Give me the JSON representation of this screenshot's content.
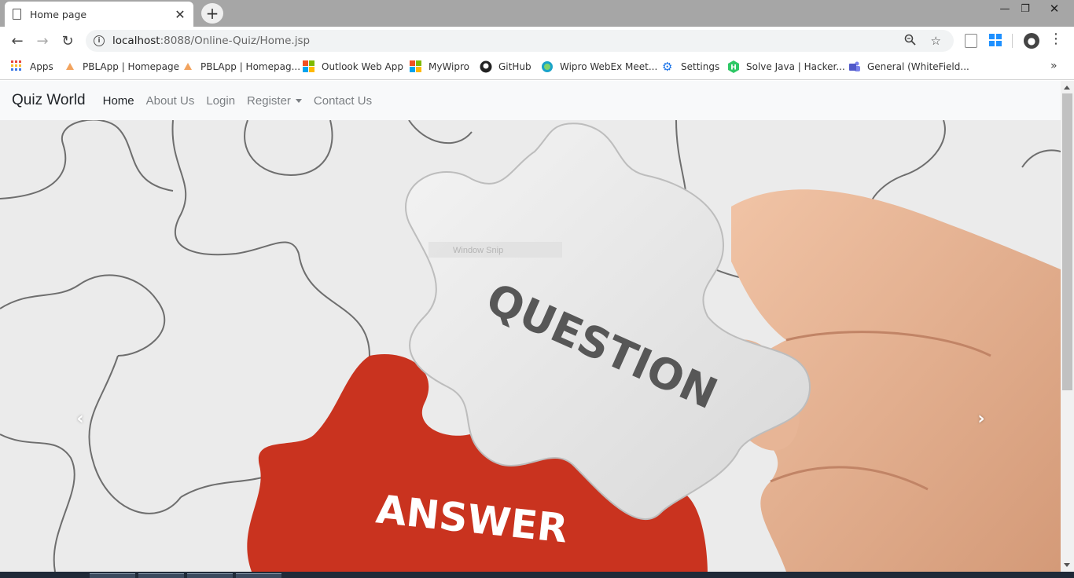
{
  "browser": {
    "tab_title": "Home page",
    "url_host": "localhost",
    "url_rest": ":8088/Online-Quiz/Home.jsp",
    "bookmarks": [
      {
        "label": "Apps",
        "icon": "apps-grid-icon"
      },
      {
        "label": "PBLApp | Homepage",
        "icon": "pblapp-icon"
      },
      {
        "label": "PBLApp | Homepag...",
        "icon": "pblapp-icon"
      },
      {
        "label": "Outlook Web App",
        "icon": "microsoft-icon"
      },
      {
        "label": "MyWipro",
        "icon": "microsoft-icon"
      },
      {
        "label": "GitHub",
        "icon": "github-icon"
      },
      {
        "label": "Wipro WebEx Meet...",
        "icon": "webex-icon"
      },
      {
        "label": "Settings",
        "icon": "gear-icon"
      },
      {
        "label": "Solve Java | Hacker...",
        "icon": "hackerrank-icon"
      },
      {
        "label": "General (WhiteField...",
        "icon": "teams-icon"
      }
    ]
  },
  "site": {
    "brand": "Quiz World",
    "nav": [
      "Home",
      "About Us",
      "Login",
      "Register",
      "Contact Us"
    ]
  },
  "hero": {
    "puzzle_piece_text": "QUESTION",
    "slot_text": "ANSWER",
    "overlay_text": "Window Snip"
  },
  "colors": {
    "answer_red": "#c9331f",
    "navbar_bg": "#f8f9fa",
    "puzzle_white": "#ecedee"
  }
}
